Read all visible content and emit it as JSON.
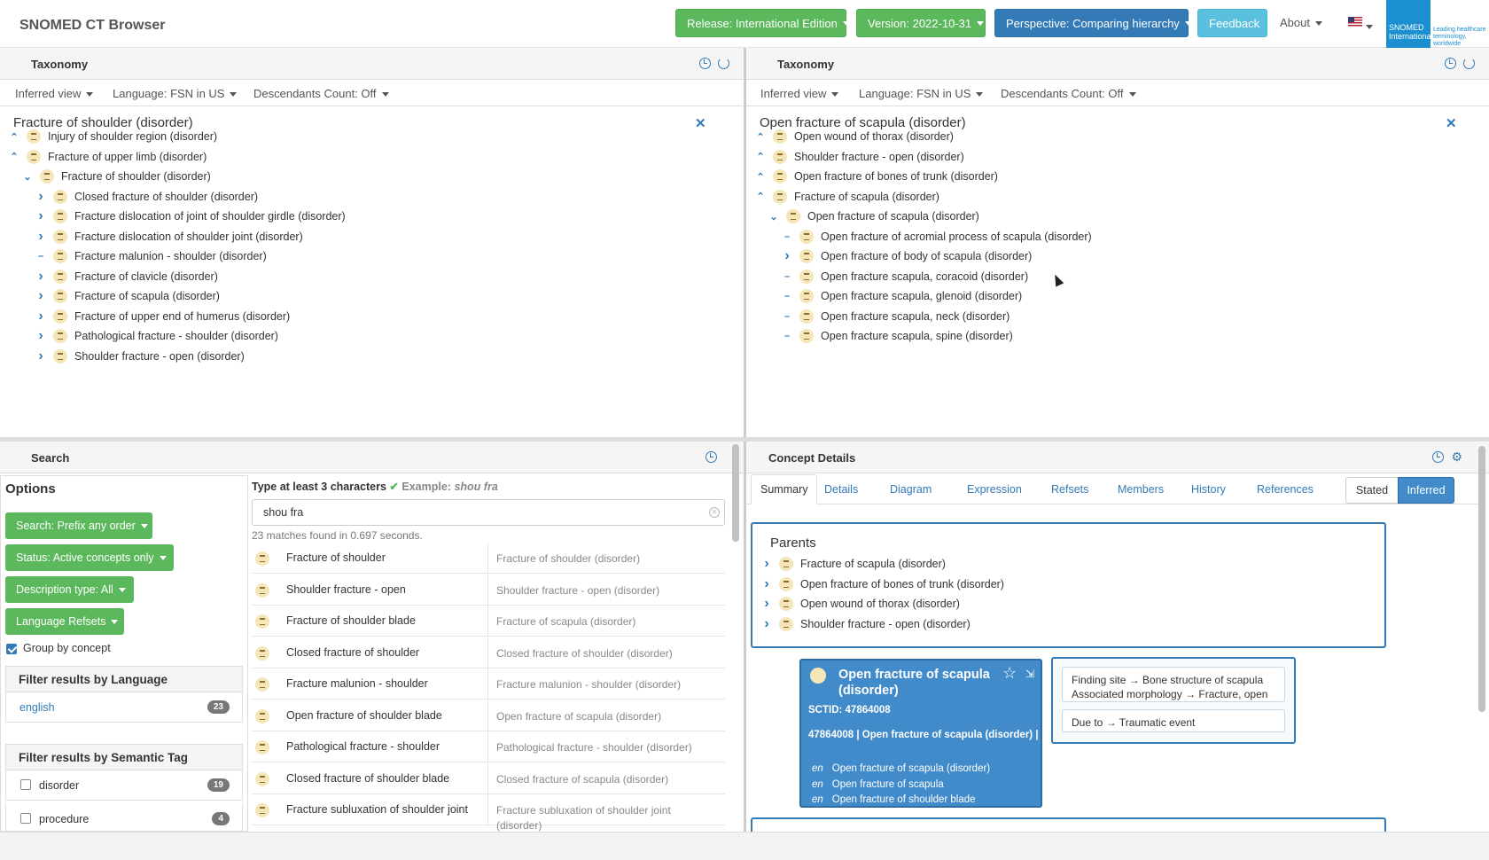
{
  "app": {
    "title": "SNOMED CT Browser"
  },
  "topbar": {
    "release": "Release: International Edition",
    "version": "Version: 2022-10-31",
    "perspective": "Perspective: Comparing hierarchy",
    "feedback": "Feedback",
    "about": "About",
    "logo_name": "SNOMED International",
    "logo_tag": "Leading healthcare terminology, worldwide"
  },
  "colors": {
    "green": "#5cb85c",
    "blue": "#337ab7",
    "cyan": "#5bc0de",
    "card": "#428bca"
  },
  "taxonomy_left": {
    "header": "Taxonomy",
    "view": "Inferred view",
    "language": "Language: FSN in US",
    "descendants": "Descendants Count: Off",
    "focus": "Fracture of shoulder (disorder)",
    "rows": [
      {
        "label": "Injury of shoulder region (disorder)",
        "toggle": "up",
        "indent": 0
      },
      {
        "label": "Fracture of upper limb (disorder)",
        "toggle": "up",
        "indent": 0
      },
      {
        "label": "Fracture of shoulder (disorder)",
        "toggle": "down",
        "indent": 1
      },
      {
        "label": "Closed fracture of shoulder (disorder)",
        "toggle": "right",
        "indent": 2
      },
      {
        "label": "Fracture dislocation of joint of shoulder girdle (disorder)",
        "toggle": "right",
        "indent": 2
      },
      {
        "label": "Fracture dislocation of shoulder joint (disorder)",
        "toggle": "right",
        "indent": 2
      },
      {
        "label": "Fracture malunion - shoulder (disorder)",
        "toggle": "leaf",
        "indent": 2
      },
      {
        "label": "Fracture of clavicle (disorder)",
        "toggle": "right",
        "indent": 2
      },
      {
        "label": "Fracture of scapula (disorder)",
        "toggle": "right",
        "indent": 2
      },
      {
        "label": "Fracture of upper end of humerus (disorder)",
        "toggle": "right",
        "indent": 2
      },
      {
        "label": "Pathological fracture - shoulder (disorder)",
        "toggle": "right",
        "indent": 2
      },
      {
        "label": "Shoulder fracture - open (disorder)",
        "toggle": "right",
        "indent": 2
      }
    ]
  },
  "taxonomy_right": {
    "header": "Taxonomy",
    "view": "Inferred view",
    "language": "Language: FSN in US",
    "descendants": "Descendants Count: Off",
    "focus": "Open fracture of scapula (disorder)",
    "rows": [
      {
        "label": "Open wound of thorax (disorder)",
        "toggle": "up",
        "indent": 0
      },
      {
        "label": "Shoulder fracture - open (disorder)",
        "toggle": "up",
        "indent": 0
      },
      {
        "label": "Open fracture of bones of trunk (disorder)",
        "toggle": "up",
        "indent": 0
      },
      {
        "label": "Fracture of scapula (disorder)",
        "toggle": "up",
        "indent": 0
      },
      {
        "label": "Open fracture of scapula (disorder)",
        "toggle": "down",
        "indent": 1
      },
      {
        "label": "Open fracture of acromial process of scapula (disorder)",
        "toggle": "leaf",
        "indent": 2
      },
      {
        "label": "Open fracture of body of scapula (disorder)",
        "toggle": "right",
        "indent": 2
      },
      {
        "label": "Open fracture scapula, coracoid (disorder)",
        "toggle": "leaf",
        "indent": 2
      },
      {
        "label": "Open fracture scapula, glenoid (disorder)",
        "toggle": "leaf",
        "indent": 2
      },
      {
        "label": "Open fracture scapula, neck (disorder)",
        "toggle": "leaf",
        "indent": 2
      },
      {
        "label": "Open fracture scapula, spine (disorder)",
        "toggle": "leaf",
        "indent": 2
      }
    ]
  },
  "search": {
    "header": "Search",
    "options_title": "Options",
    "mode": "Search: Prefix any order",
    "status": "Status: Active concepts only",
    "desc_type": "Description type: All",
    "lang_refsets": "Language Refsets",
    "group_by": "Group by concept",
    "filter_lang_title": "Filter results by Language",
    "lang_filters": [
      {
        "label": "english",
        "count": "23"
      }
    ],
    "filter_tag_title": "Filter results by Semantic Tag",
    "tag_filters": [
      {
        "label": "disorder",
        "count": "19"
      },
      {
        "label": "procedure",
        "count": "4"
      }
    ],
    "hint": "Type at least 3 characters",
    "example_label": "Example:",
    "example_value": "shou fra",
    "query": "shou fra",
    "matches": "23 matches found in 0.697 seconds.",
    "results": [
      {
        "term": "Fracture of shoulder",
        "fsn": "Fracture of shoulder (disorder)"
      },
      {
        "term": "Shoulder fracture - open",
        "fsn": "Shoulder fracture - open (disorder)"
      },
      {
        "term": "Fracture of shoulder blade",
        "fsn": "Fracture of scapula (disorder)"
      },
      {
        "term": "Closed fracture of shoulder",
        "fsn": "Closed fracture of shoulder (disorder)"
      },
      {
        "term": "Fracture malunion - shoulder",
        "fsn": "Fracture malunion - shoulder (disorder)"
      },
      {
        "term": "Open fracture of shoulder blade",
        "fsn": "Open fracture of scapula (disorder)"
      },
      {
        "term": "Pathological fracture - shoulder",
        "fsn": "Pathological fracture - shoulder (disorder)"
      },
      {
        "term": "Closed fracture of shoulder blade",
        "fsn": "Closed fracture of scapula (disorder)"
      },
      {
        "term": "Fracture subluxation of shoulder joint",
        "fsn": "Fracture subluxation of shoulder joint (disorder)"
      }
    ]
  },
  "details": {
    "header": "Concept Details",
    "tabs": [
      "Summary",
      "Details",
      "Diagram",
      "Expression",
      "Refsets",
      "Members",
      "History",
      "References"
    ],
    "stated": "Stated",
    "inferred": "Inferred",
    "parents_title": "Parents",
    "parents": [
      "Fracture of scapula (disorder)",
      "Open fracture of bones of trunk (disorder)",
      "Open wound of thorax (disorder)",
      "Shoulder fracture - open (disorder)"
    ],
    "concept": {
      "title": "Open fracture of scapula (disorder)",
      "sctid": "SCTID: 47864008",
      "full": "47864008 | Open fracture of scapula (disorder) |",
      "descriptions": [
        {
          "lang": "en",
          "term": "Open fracture of scapula (disorder)"
        },
        {
          "lang": "en",
          "term": "Open fracture of scapula"
        },
        {
          "lang": "en",
          "term": "Open fracture of shoulder blade"
        }
      ]
    },
    "attributes": {
      "group1": [
        "Finding site → Bone structure of scapula",
        "Associated morphology → Fracture, open"
      ],
      "group2": [
        "Due to → Traumatic event"
      ]
    }
  }
}
